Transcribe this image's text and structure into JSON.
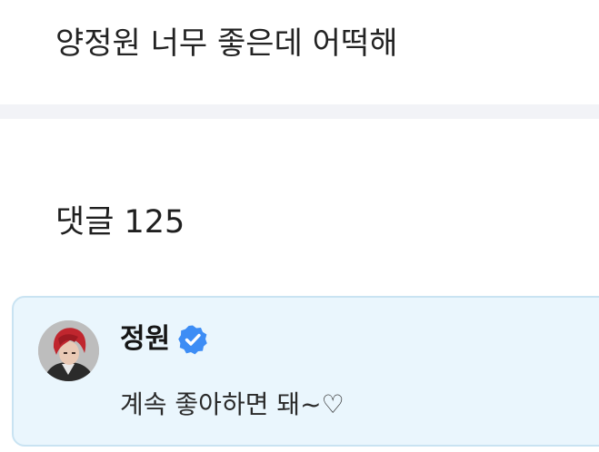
{
  "post": {
    "title": "양정원 너무 좋은데 어떡해"
  },
  "comments": {
    "heading": "댓글 125",
    "items": [
      {
        "author": "정원",
        "verified": true,
        "text": "계속 좋아하면 돼~♡",
        "avatar_icon": "profile-photo"
      }
    ]
  },
  "colors": {
    "card_background": "#eaf6fd",
    "card_border": "#c9e3f2",
    "verified_badge": "#3d8df5",
    "divider": "#f2f3f7"
  }
}
